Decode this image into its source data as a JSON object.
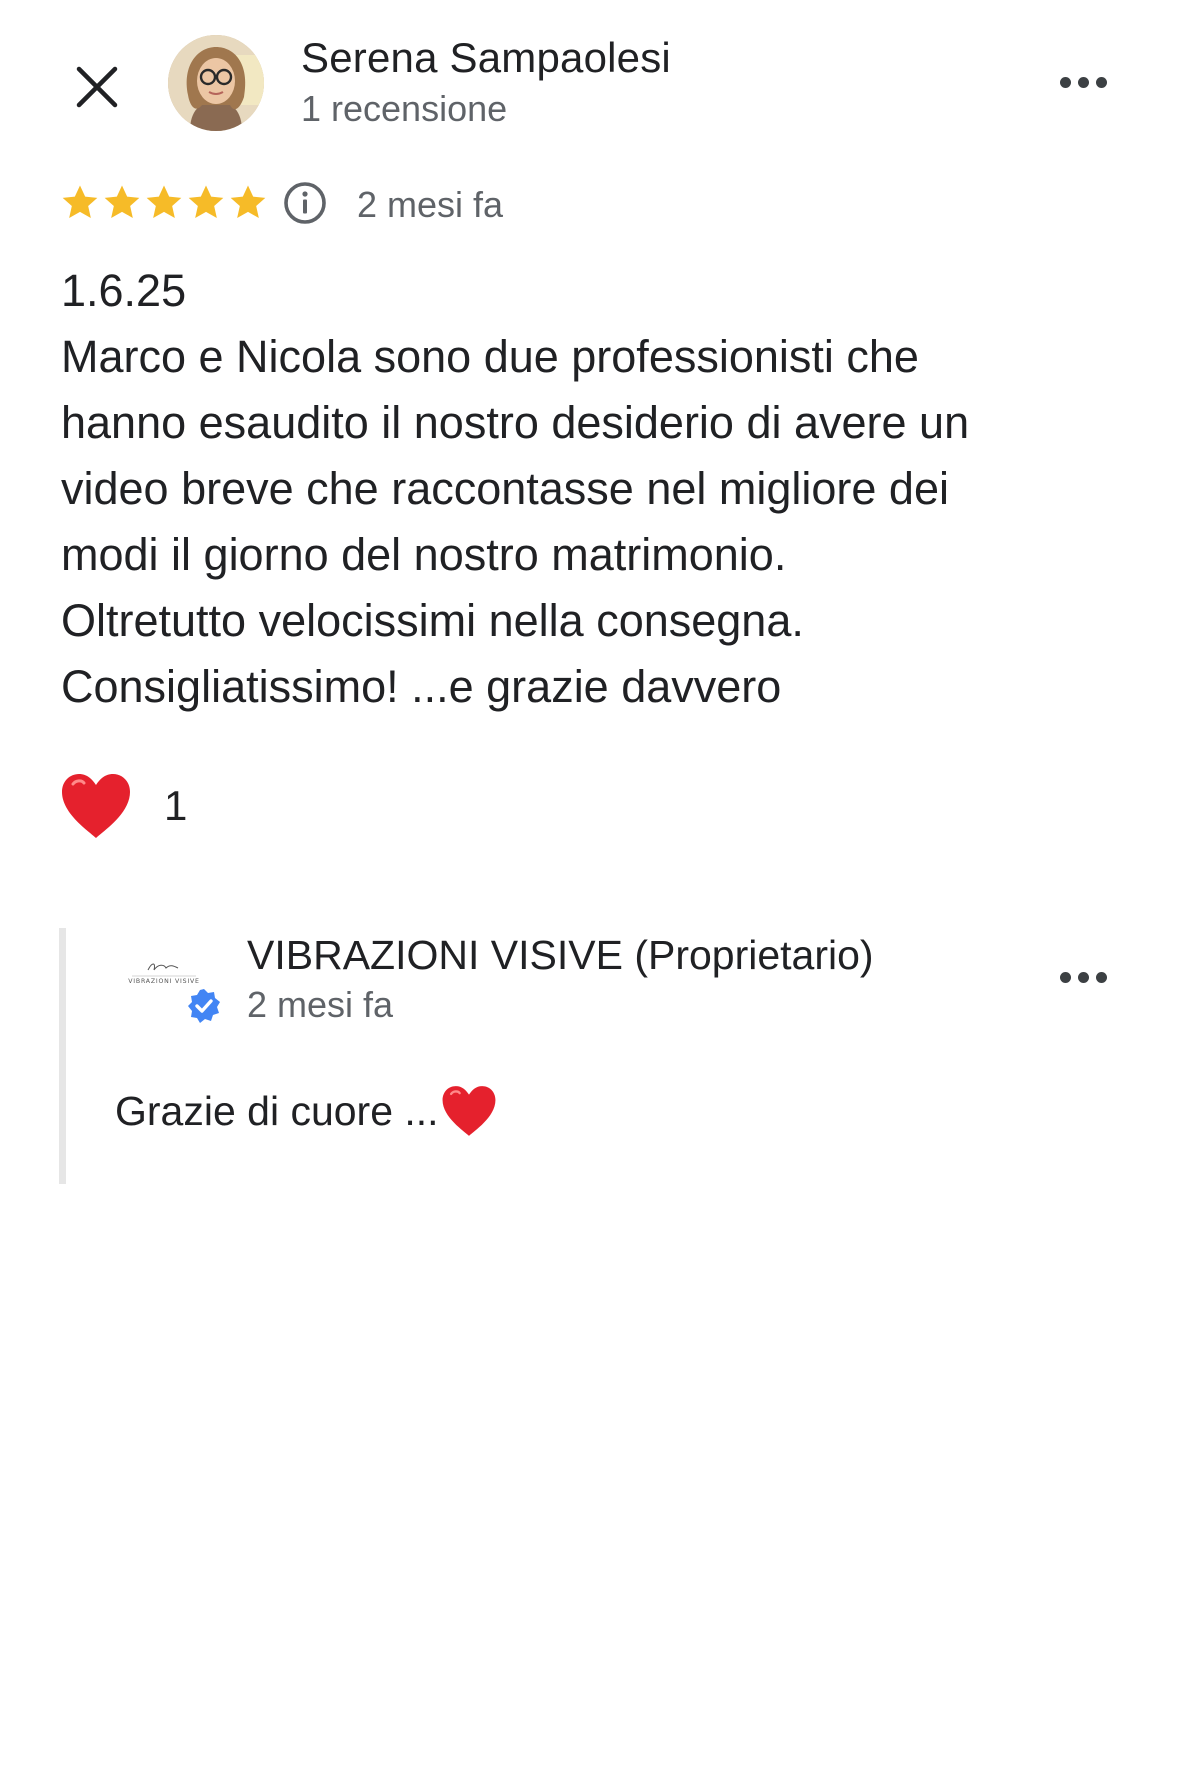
{
  "header": {
    "author_name": "Serena Sampaolesi",
    "author_subtitle": "1 recensione",
    "close_icon": "close-icon",
    "more_icon": "more-horiz-icon"
  },
  "review": {
    "rating": 5,
    "rating_max": 5,
    "star_color": "#F6BB28",
    "date": "2 mesi fa",
    "text_lines": [
      "1.6.25",
      "Marco e Nicola sono due professionisti che",
      "hanno esaudito il nostro desiderio di avere un",
      "video breve che raccontasse nel migliore dei",
      "modi il giorno del nostro matrimonio.",
      "Oltretutto velocissimi nella consegna.",
      "Consigliatissimo! ...e grazie davvero"
    ]
  },
  "reaction": {
    "icon": "heart-icon",
    "count": "1"
  },
  "owner_reply": {
    "name": "VIBRAZIONI VISIVE (Proprietario)",
    "date": "2 mesi fa",
    "text": "Grazie di cuore ...",
    "verified_color": "#4285F4",
    "logo_text": "VIBRAZIONI VISIVE"
  }
}
